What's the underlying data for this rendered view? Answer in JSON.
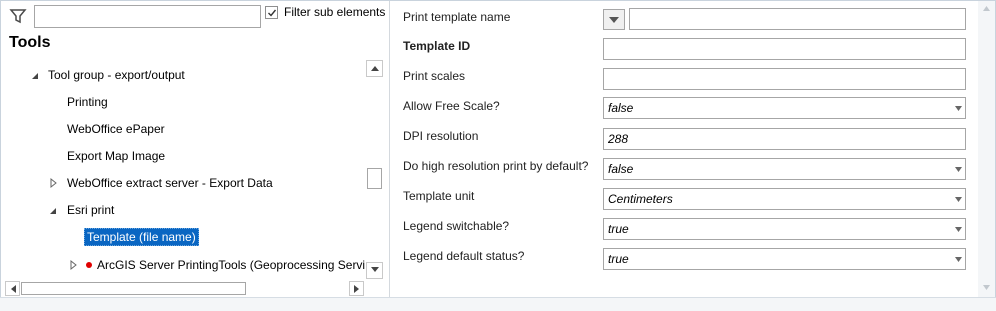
{
  "filter": {
    "icon": "filter-icon",
    "input_value": "",
    "checkbox_label": "Filter sub elements",
    "checkbox_checked": true
  },
  "tools_title": "Tools",
  "tree": {
    "nodes": [
      {
        "label": "Tool group - export/output",
        "expander": "expanded"
      },
      {
        "label": "Printing",
        "expander": "none"
      },
      {
        "label": "WebOffice ePaper",
        "expander": "none"
      },
      {
        "label": "Export Map Image",
        "expander": "none"
      },
      {
        "label": "WebOffice extract server - Export Data",
        "expander": "collapsed"
      },
      {
        "label": "Esri print",
        "expander": "expanded"
      },
      {
        "label": "Template (file name)",
        "expander": "none",
        "selected": true
      },
      {
        "label": "ArcGIS Server PrintingTools (Geoprocessing Service)",
        "expander": "collapsed",
        "status": "error"
      }
    ]
  },
  "properties": {
    "print_template_name": {
      "label": "Print template name",
      "value": ""
    },
    "template_id": {
      "label": "Template ID",
      "value": ""
    },
    "print_scales": {
      "label": "Print scales",
      "value": ""
    },
    "allow_free_scale": {
      "label": "Allow Free Scale?",
      "value": "false"
    },
    "dpi_resolution": {
      "label": "DPI resolution",
      "value": "288"
    },
    "high_res_default": {
      "label": "Do high resolution print by default?",
      "value": "false"
    },
    "template_unit": {
      "label": "Template unit",
      "value": "Centimeters"
    },
    "legend_switchable": {
      "label": "Legend switchable?",
      "value": "true"
    },
    "legend_default_status": {
      "label": "Legend default status?",
      "value": "true"
    }
  },
  "colors": {
    "selection": "#0a66c2",
    "error_dot": "#e00000",
    "border": "#a6a6a6"
  }
}
